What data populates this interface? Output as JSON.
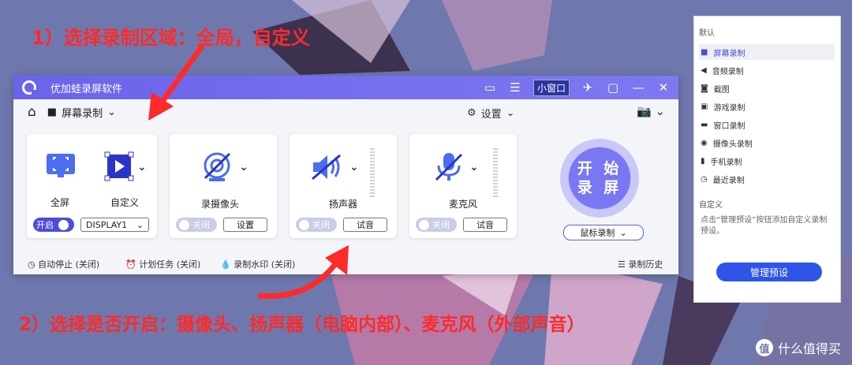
{
  "annotations": {
    "step1": "1）选择录制区域：全局，自定义",
    "step2": "2）选择是否开启：摄像头、扬声器（电脑内部）、麦克风（外部声音）"
  },
  "window": {
    "title": "优加蛙录屏软件",
    "mini_window": "小窗口",
    "mode_label": "屏幕录制",
    "settings_label": "设置"
  },
  "cards": {
    "fullscreen_label": "全屏",
    "custom_label": "自定义",
    "region_toggle": "开启",
    "display_select": "DISPLAY1",
    "camera_label": "录摄像头",
    "camera_toggle": "关闭",
    "camera_btn": "设置",
    "speaker_label": "扬声器",
    "speaker_toggle": "关闭",
    "speaker_btn": "试音",
    "mic_label": "麦克风",
    "mic_toggle": "关闭",
    "mic_btn": "试音"
  },
  "start": {
    "line1": "开 始",
    "line2": "录 屏"
  },
  "mouse_mode": "鼠标录制",
  "footer": {
    "auto_stop": "自动停止 (关闭)",
    "schedule": "计划任务 (关闭)",
    "watermark": "录制水印 (关闭)",
    "history": "录制历史"
  },
  "panel": {
    "default_header": "默认",
    "items": [
      "屏幕录制",
      "音频录制",
      "截图",
      "游戏录制",
      "窗口录制",
      "摄像头录制",
      "手机录制",
      "最近录制"
    ],
    "custom_header": "自定义",
    "custom_desc": "点击“管理预设”按钮添加自定义录制预设。",
    "manage_btn": "管理预设"
  },
  "watermark_brand": "什么值得买",
  "colors": {
    "accent": "#4b4dd8",
    "annotation": "#ff2a2a",
    "manage": "#2e55e8"
  }
}
